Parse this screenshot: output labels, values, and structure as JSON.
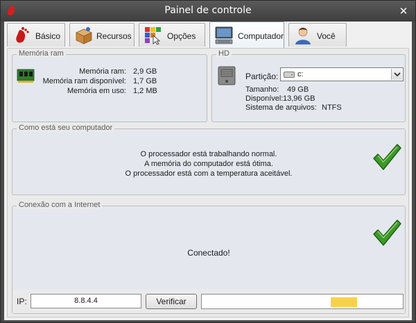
{
  "window": {
    "title": "Painel de controle",
    "close_symbol": "✕"
  },
  "tabs": [
    {
      "label": "Básico",
      "icon": "gnome-foot-icon",
      "active": false
    },
    {
      "label": "Recursos",
      "icon": "package-box-icon",
      "active": false
    },
    {
      "label": "Opções",
      "icon": "options-grid-icon",
      "active": false
    },
    {
      "label": "Computador",
      "icon": "computer-icon",
      "active": true
    },
    {
      "label": "Você",
      "icon": "user-icon",
      "active": false
    }
  ],
  "memory": {
    "title": "Memória ram",
    "icon": "ram-module-icon",
    "rows": [
      {
        "label": "Memória ram:",
        "value": "2,9 GB"
      },
      {
        "label": "Memória ram disponível:",
        "value": "1,7 GB"
      },
      {
        "label": "Memória em uso:",
        "value": "1,2 MB"
      }
    ]
  },
  "hd": {
    "title": "HD",
    "icon": "hard-disk-icon",
    "partition_label": "Partição:",
    "partition_value": "c:",
    "rows": [
      {
        "label": "Tamanho:",
        "value": "49 GB"
      },
      {
        "label": "Disponível:",
        "value": "13,96 GB"
      },
      {
        "label": "Sistema de arquivos:",
        "value": "NTFS"
      }
    ]
  },
  "status": {
    "title": "Como está seu computador",
    "lines": [
      "O processador está trabalhando normal.",
      "A memória do computador está ótima.",
      "O processador está com a temperatura aceitável."
    ],
    "icon": "checkmark-icon"
  },
  "internet": {
    "title": "Conexão com a Internet",
    "message": "Conectado!",
    "icon": "checkmark-icon",
    "ip_label": "IP:",
    "ip_value": "8.8.4.4",
    "verify_label": "Verificar",
    "progress_fraction": 0.13
  },
  "colors": {
    "check_green": "#3d9a2a",
    "progress_yellow": "#f8d14c",
    "active_tab_border": "#8aa0b8"
  }
}
